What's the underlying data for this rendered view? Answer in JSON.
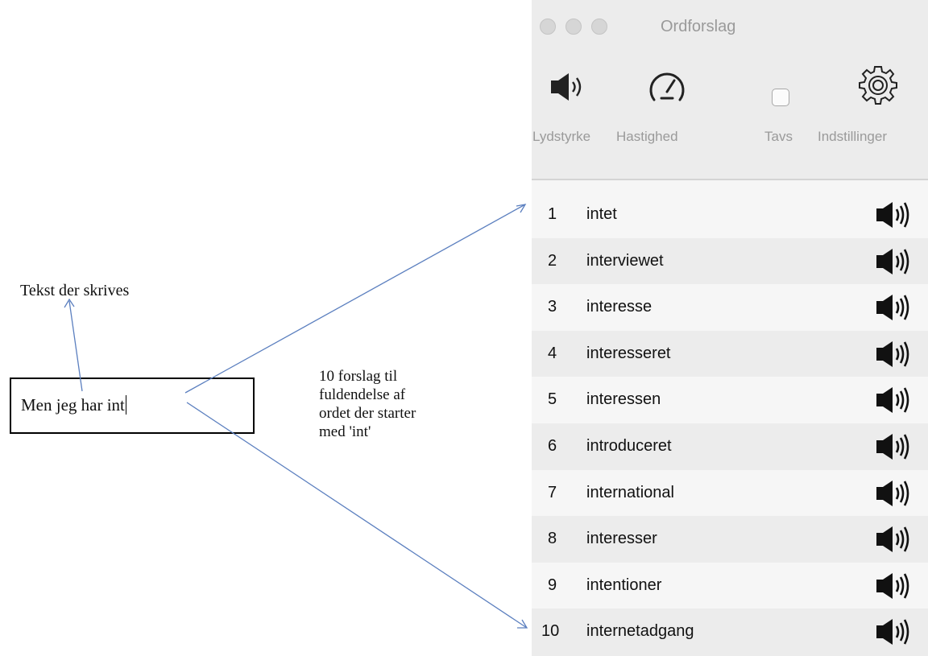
{
  "annotation": {
    "typed_label": "Tekst der skrives",
    "typed_text": "Men jeg har int",
    "description_lines": [
      "10 forslag til",
      "fuldendelse af",
      "ordet der starter",
      "med 'int'"
    ]
  },
  "window": {
    "title": "Ordforslag",
    "toolbar": {
      "volume_label": "Lydstyrke",
      "speed_label": "Hastighed",
      "mute_label": "Tavs",
      "mute_checked": false,
      "settings_label": "Indstillinger"
    },
    "suggestions": [
      {
        "num": "1",
        "word": "intet"
      },
      {
        "num": "2",
        "word": "interviewet"
      },
      {
        "num": "3",
        "word": "interesse"
      },
      {
        "num": "4",
        "word": "interesseret"
      },
      {
        "num": "5",
        "word": "interessen"
      },
      {
        "num": "6",
        "word": "introduceret"
      },
      {
        "num": "7",
        "word": "international"
      },
      {
        "num": "8",
        "word": "interesser"
      },
      {
        "num": "9",
        "word": "intentioner"
      },
      {
        "num": "10",
        "word": "internetadgang"
      }
    ]
  },
  "icons": {
    "speaker": "speaker-icon",
    "speedometer": "speedometer-icon",
    "gear": "gear-icon",
    "row_speaker": "speaker-icon"
  },
  "colors": {
    "arrow": "#5b7fbf",
    "window_bg": "#ececec",
    "row_alt": "#f6f6f6",
    "muted_text": "#9a9a9a"
  }
}
